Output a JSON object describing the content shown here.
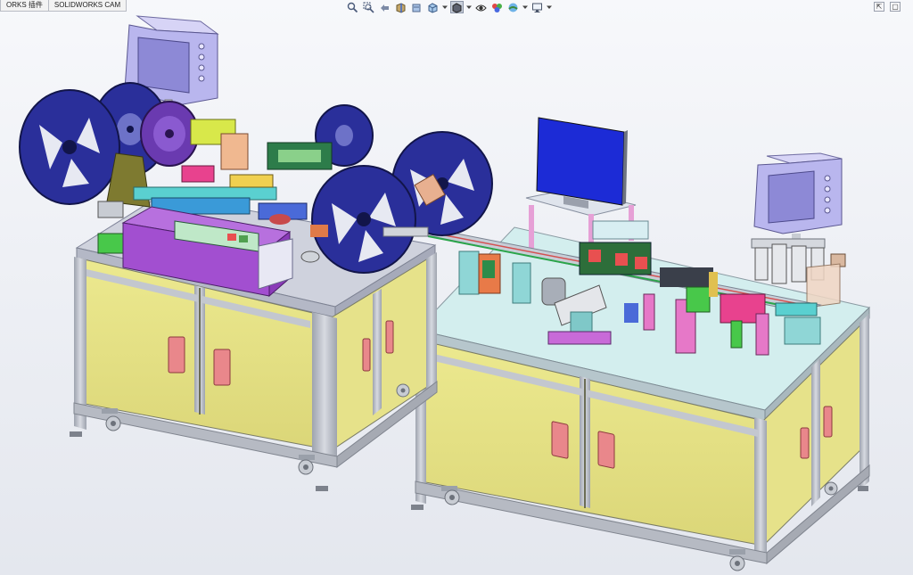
{
  "command_manager": {
    "tabs": [
      {
        "label": "ORKS 插件"
      },
      {
        "label": "SOLIDWORKS CAM"
      }
    ]
  },
  "heads_up_toolbar": {
    "tools": [
      {
        "icon": "zoom-to-fit-icon"
      },
      {
        "icon": "zoom-to-area-icon"
      },
      {
        "icon": "previous-view-icon"
      },
      {
        "icon": "section-view-icon"
      },
      {
        "icon": "dynamic-annotation-view-icon"
      },
      {
        "icon": "view-orientation-icon"
      },
      {
        "icon": "display-style-icon"
      },
      {
        "icon": "hide-show-items-icon"
      },
      {
        "icon": "edit-appearance-icon"
      },
      {
        "icon": "apply-scene-icon"
      },
      {
        "icon": "view-settings-icon"
      }
    ]
  },
  "graphics_area": {
    "model": "two-table automated reel-to-reel assembly machine",
    "background_top": "#f7f8fb",
    "background_bottom": "#e4e7ee"
  },
  "colors": {
    "cabinet_panel": "#e3df86",
    "frame": "#b8bcc6",
    "reel": "#2a2f9a",
    "tabletop": "#cfeaea",
    "handle": "#e9878b",
    "purple_block": "#a24fd0",
    "hmi": "#b9b6ee",
    "monitor": "#1c2bd6"
  }
}
